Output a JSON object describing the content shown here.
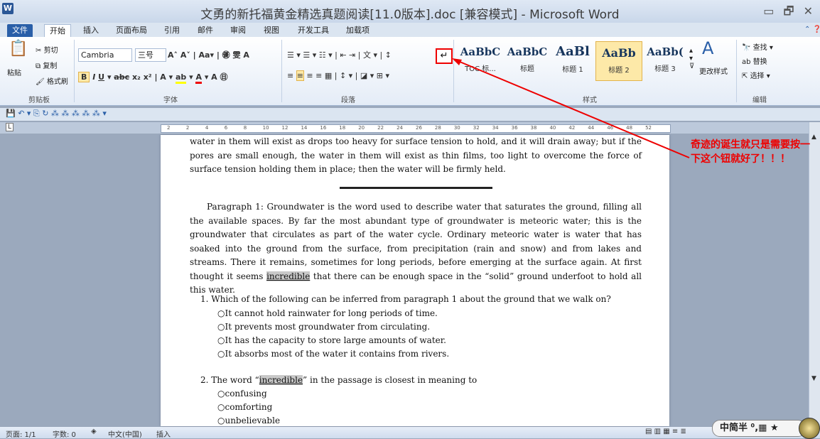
{
  "window": {
    "title": "文勇的新托福黄金精选真题阅读[11.0版本].doc [兼容模式] - Microsoft Word",
    "controls": "▭ 🗗 ✕"
  },
  "tabs": [
    "文件",
    "开始",
    "插入",
    "页面布局",
    "引用",
    "邮件",
    "审阅",
    "视图",
    "开发工具",
    "加载项"
  ],
  "clipboard": {
    "paste": "粘贴",
    "cut": "剪切",
    "copy": "复制",
    "format_painter": "格式刷",
    "label": "剪贴板"
  },
  "font": {
    "name": "Cambria",
    "size": "三号",
    "label": "字体"
  },
  "paragraph": {
    "label": "段落",
    "show_marks": "↵"
  },
  "styles": {
    "items": [
      {
        "sample": "AaBbC",
        "label": "TOC 标..."
      },
      {
        "sample": "AaBbC",
        "label": "标题"
      },
      {
        "sample": "AaBl",
        "label": "标题 1"
      },
      {
        "sample": "AaBb",
        "label": "标题 2"
      },
      {
        "sample": "AaBb(",
        "label": "标题 3"
      }
    ],
    "change_styles": "更改样式",
    "label": "样式"
  },
  "editing": {
    "find": "查找",
    "replace": "替换",
    "select": "选择",
    "label": "编辑"
  },
  "ruler": {
    "ticks": [
      "2",
      "2",
      "4",
      "6",
      "8",
      "10",
      "12",
      "14",
      "16",
      "18",
      "20",
      "22",
      "24",
      "26",
      "28",
      "30",
      "32",
      "34",
      "36",
      "38",
      "40",
      "42",
      "44",
      "46",
      "48",
      "52"
    ]
  },
  "document": {
    "top_paragraph": "water in them will exist as drops too heavy for surface tension to hold, and it will drain away; but if the pores are small enough, the water in them will exist as thin films, too light to overcome the force of surface tension holding them in place; then the water will be firmly held.",
    "para1_a": "Paragraph 1: Groundwater is the word used to describe water that saturates the ground, filling all the available spaces. By far the most abundant type of groundwater is meteoric water; this is the groundwater that circulates as part of the water cycle. Ordinary meteoric water is water that has soaked into the ground from the surface, from precipitation (rain and snow) and from lakes and streams. There it remains, sometimes for long periods, before emerging at the surface again. At first thought it seems ",
    "para1_hl": "incredible",
    "para1_b": " that there can be enough space in the “solid” ground underfoot to hold all this water.",
    "q1": {
      "stem": "1. Which of the following can be inferred from paragraph 1 about the ground that we walk on?",
      "options": [
        "○It cannot hold rainwater for long periods of time.",
        "○It prevents most groundwater from circulating.",
        "○It has the capacity to store large amounts of water.",
        "○It absorbs most of the water it contains from rivers."
      ]
    },
    "q2": {
      "stem_a": "2. The word “",
      "stem_hl": "incredible",
      "stem_b": "” in the passage is closest in meaning to",
      "options": [
        "○confusing",
        "○comforting",
        "○unbelievable"
      ]
    }
  },
  "annotation": "奇迹的诞生就只是需要按一下这个钮就好了！！！",
  "status": {
    "page": "页面: 1/1",
    "words": "字数: 0",
    "lang": "中文(中国)",
    "mode": "插入"
  },
  "ime": "中简半 ⁰,▦ ★",
  "colors": {
    "accent": "#2a5fa8",
    "annotation": "#e00000",
    "highlight": "#c8c8c8"
  }
}
